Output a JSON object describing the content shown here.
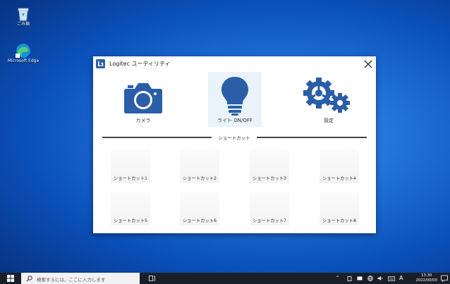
{
  "desktop": {
    "icons": [
      {
        "label": "ごみ箱",
        "icon": "recycle-bin-icon"
      },
      {
        "label": "Microsoft Edge",
        "icon": "edge-icon"
      }
    ]
  },
  "dialog": {
    "title": "Logitec ユーティリティ",
    "close_icon": "close-icon",
    "buttons": [
      {
        "label": "カメラ",
        "icon": "camera-icon"
      },
      {
        "label": "ライト ON/OFF",
        "icon": "bulb-icon"
      },
      {
        "label": "設定",
        "icon": "gears-icon"
      }
    ],
    "shortcut_section_label": "ショートカット",
    "shortcuts": [
      {
        "label": "ショートカット1"
      },
      {
        "label": "ショートカット2"
      },
      {
        "label": "ショートカット3"
      },
      {
        "label": "ショートカット4"
      },
      {
        "label": "ショートカット5"
      },
      {
        "label": "ショートカット6"
      },
      {
        "label": "ショートカット7"
      },
      {
        "label": "ショートカット8"
      }
    ],
    "accent_color": "#2a5ea7"
  },
  "taskbar": {
    "search_placeholder": "検索するには、ここに入力します",
    "ime_label": "A",
    "time": "13:30",
    "date": "2022/00/00"
  }
}
